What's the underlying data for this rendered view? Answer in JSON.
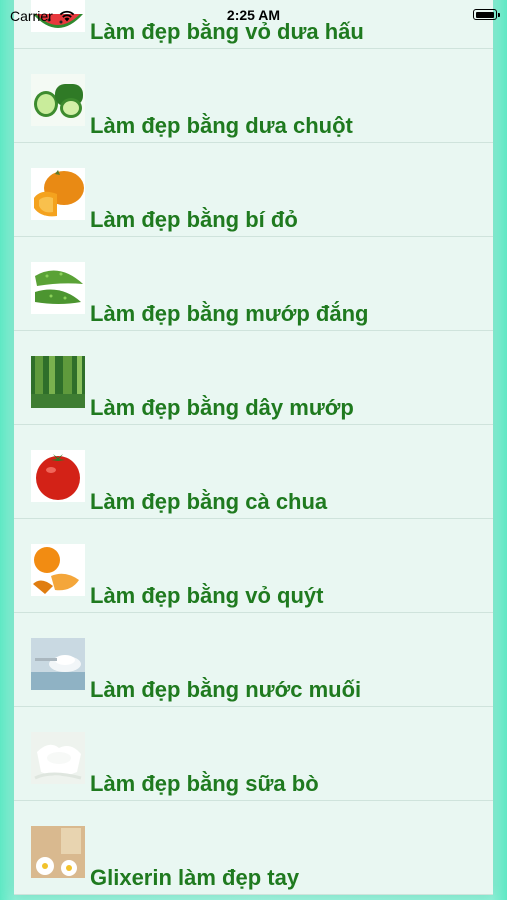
{
  "status_bar": {
    "carrier": "Carrier",
    "time": "2:25 AM"
  },
  "list": {
    "items": [
      {
        "label": "Làm đẹp bằng vỏ dưa hấu",
        "icon": "watermelon-thumbnail"
      },
      {
        "label": "Làm đẹp bằng dưa chuột",
        "icon": "cucumber-thumbnail"
      },
      {
        "label": "Làm đẹp bằng bí đỏ",
        "icon": "pumpkin-thumbnail"
      },
      {
        "label": "Làm đẹp bằng mướp đắng",
        "icon": "bitter-melon-thumbnail"
      },
      {
        "label": "Làm đẹp bằng dây mướp",
        "icon": "luffa-vine-thumbnail"
      },
      {
        "label": "Làm đẹp bằng cà chua",
        "icon": "tomato-thumbnail"
      },
      {
        "label": "Làm đẹp bằng vỏ quýt",
        "icon": "tangerine-peel-thumbnail"
      },
      {
        "label": "Làm đẹp bằng nước muối",
        "icon": "salt-water-thumbnail"
      },
      {
        "label": "Làm đẹp bằng sữa bò",
        "icon": "cow-milk-thumbnail"
      },
      {
        "label": "Glixerin làm đẹp tay",
        "icon": "glycerin-thumbnail"
      }
    ]
  },
  "colors": {
    "label_text": "#1f7a1f",
    "list_bg": "#e9f7f2",
    "page_bg": "#9ef3dd"
  }
}
